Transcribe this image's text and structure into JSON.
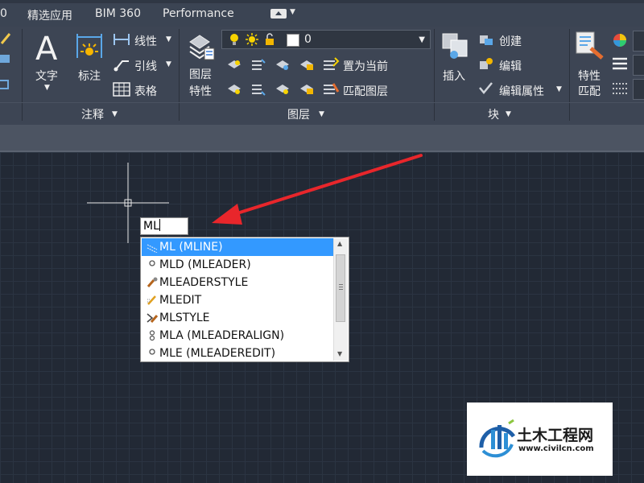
{
  "menubar": {
    "items": [
      "0",
      "精选应用",
      "BIM 360",
      "Performance"
    ]
  },
  "ribbon": {
    "annotate": {
      "text_label": "文字",
      "dim_label": "标注",
      "linear_label": "线性",
      "leader_label": "引线",
      "table_label": "表格",
      "panel_title": "注释"
    },
    "layers": {
      "props_label_line1": "图层",
      "props_label_line2": "特性",
      "layer_value": "0",
      "set_current_label": "置为当前",
      "match_layer_label": "匹配图层",
      "panel_title": "图层"
    },
    "block": {
      "insert_label": "插入",
      "create_label": "创建",
      "edit_label": "编辑",
      "edit_attr_label": "编辑属性",
      "panel_title": "块"
    },
    "properties": {
      "match_label_line1": "特性",
      "match_label_line2": "匹配"
    }
  },
  "command": {
    "input_value": "ML"
  },
  "autocomplete": {
    "items": [
      {
        "label": "ML (MLINE)",
        "icon": "mline-icon",
        "selected": true
      },
      {
        "label": "MLD (MLEADER)",
        "icon": "mleader-icon",
        "selected": false
      },
      {
        "label": "MLEADERSTYLE",
        "icon": "mleaderstyle-icon",
        "selected": false
      },
      {
        "label": "MLEDIT",
        "icon": "mledit-icon",
        "selected": false
      },
      {
        "label": "MLSTYLE",
        "icon": "mlstyle-icon",
        "selected": false
      },
      {
        "label": "MLA (MLEADERALIGN)",
        "icon": "mleaderalign-icon",
        "selected": false
      },
      {
        "label": "MLE (MLEADEREDIT)",
        "icon": "mleaderedit-icon",
        "selected": false
      }
    ]
  },
  "watermark": {
    "brand": "土木工程网",
    "url": "www.civilcn.com"
  },
  "colors": {
    "selection": "#3399ff",
    "arrow": "#e8262b",
    "ribbon_bg": "#3d4554",
    "canvas_bg": "#222935"
  }
}
